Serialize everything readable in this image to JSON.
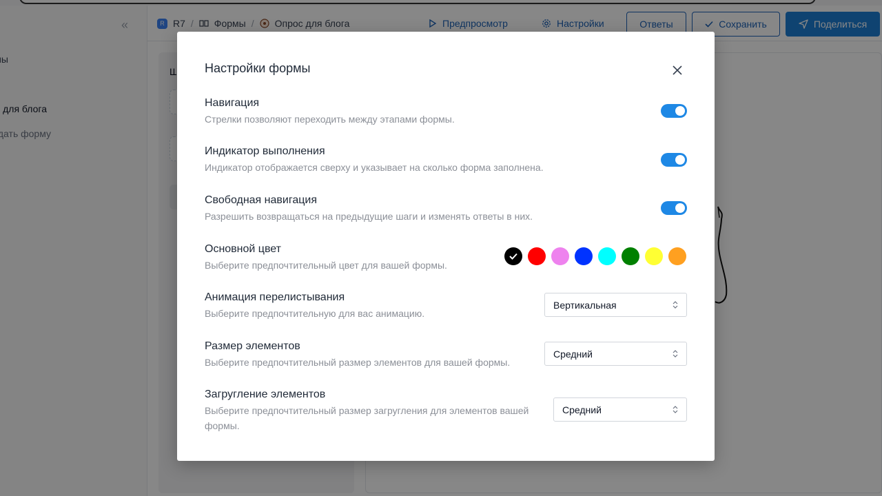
{
  "sidebar": {
    "collapse_icon": "double-chevron-left-icon",
    "collapse_glyph": "«",
    "item1": "Формы",
    "item2": "Опрос для блога",
    "item3": "Создать форму"
  },
  "header": {
    "breadcrumb": {
      "workspace_badge": "R",
      "workspace": "R7",
      "forms": "Формы",
      "form_name": "Опрос для блога"
    },
    "preview_label": "Предпросмотр",
    "settings_label": "Настройки",
    "answers_label": "Ответы",
    "save_label": "Сохранить",
    "share_label": "Поделиться"
  },
  "left_panel": {
    "title": "Шаблоны"
  },
  "modal": {
    "title": "Настройки формы",
    "settings": [
      {
        "label": "Навигация",
        "description": "Стрелки позволяют переходить между этапами формы.",
        "enabled": true
      },
      {
        "label": "Индикатор выполнения",
        "description": "Индикатор отображается сверху и указывает на сколько форма заполнена.",
        "enabled": true
      },
      {
        "label": "Свободная навигация",
        "description": "Разрешить возвращаться на предыдущие шаги и изменять ответы в них.",
        "enabled": true
      }
    ],
    "color": {
      "label": "Основной цвет",
      "description": "Выберите предпочтительный цвет для вашей формы.",
      "options": [
        "#000000",
        "#ff0000",
        "#ee82ee",
        "#0033ff",
        "#00ffff",
        "#008000",
        "#ffff33",
        "#ffa020"
      ],
      "selected": "#000000"
    },
    "animation": {
      "label": "Анимация перелистывания",
      "description": "Выберите предпочтительную для вас анимацию.",
      "value": "Вертикальная"
    },
    "size": {
      "label": "Размер элементов",
      "description": "Выберите предпочтительный размер элементов для вашей формы.",
      "value": "Средний"
    },
    "rounding": {
      "label": "Загругление элементов",
      "description": "Выберите предпочтительный размер загругления для элементов вашей формы.",
      "value": "Средний"
    }
  }
}
